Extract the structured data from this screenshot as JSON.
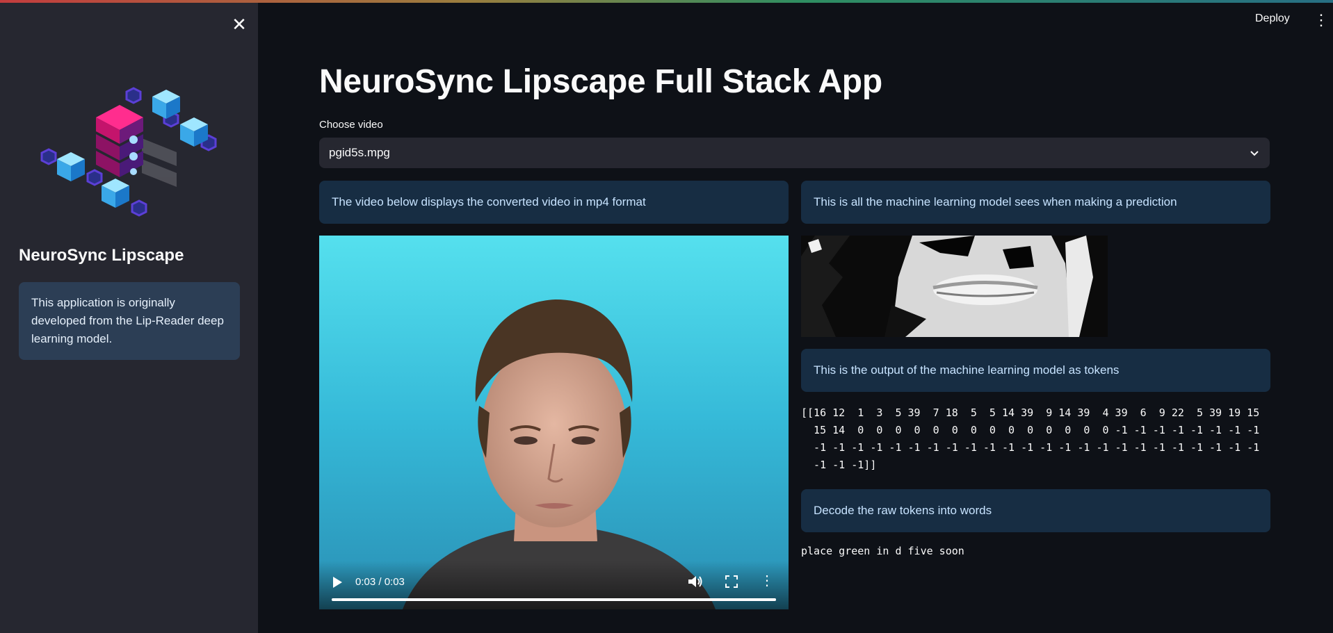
{
  "sidebar": {
    "close_glyph": "✕",
    "title": "NeuroSync Lipscape",
    "info": "This application is originally developed from the Lip-Reader deep learning model."
  },
  "header": {
    "deploy_label": "Deploy",
    "menu_glyph": "⋮"
  },
  "main": {
    "title": "NeuroSync Lipscape Full Stack App",
    "select_label": "Choose video",
    "select_value": "pgid5s.mpg",
    "video_info": "The video below displays the converted video in mp4 format",
    "model_info": "This is all the machine learning model sees when making a prediction",
    "tokens_info": "This is the output of the machine learning model as tokens",
    "tokens_text": "[[16 12  1  3  5 39  7 18  5  5 14 39  9 14 39  4 39  6  9 22  5 39 19 15\n  15 14  0  0  0  0  0  0  0  0  0  0  0  0  0  0 -1 -1 -1 -1 -1 -1 -1 -1\n  -1 -1 -1 -1 -1 -1 -1 -1 -1 -1 -1 -1 -1 -1 -1 -1 -1 -1 -1 -1 -1 -1 -1 -1\n  -1 -1 -1]]",
    "decode_info": "Decode the raw tokens into words",
    "decoded_text": "place green in d five soon"
  },
  "video_player": {
    "time": "0:03 / 0:03",
    "progress": 1.0,
    "more_glyph": "⋮"
  },
  "colors": {
    "app_bg": "#0e1117",
    "sidebar_bg": "#262730",
    "info_bg": "#172d43",
    "info_text": "#c7e3ff",
    "video_bg": "#3ec6de"
  }
}
